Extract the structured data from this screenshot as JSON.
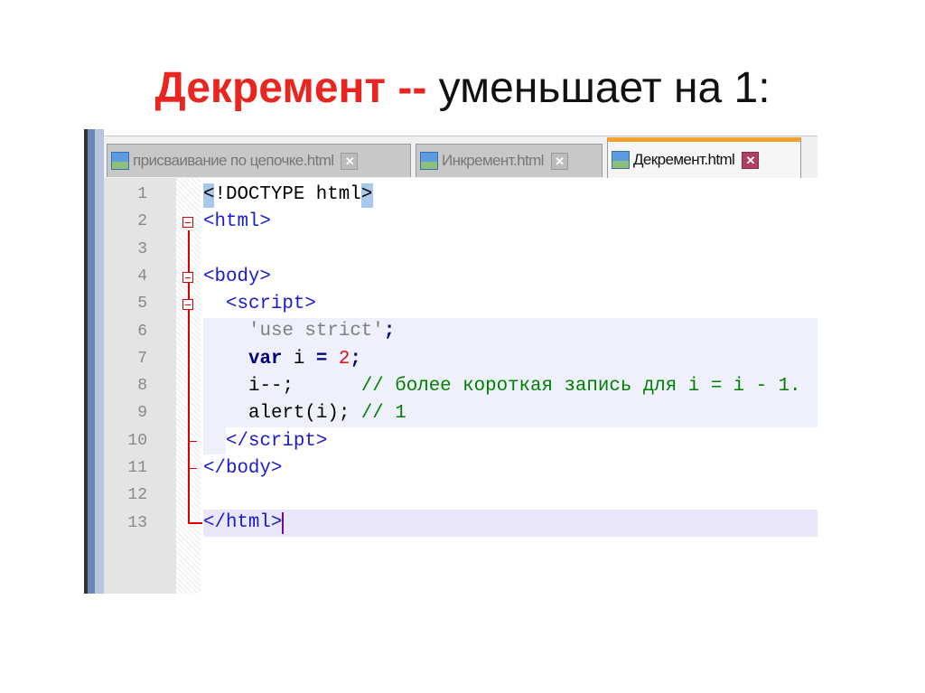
{
  "slide": {
    "title_bold": "Декремент --",
    "title_rest": " уменьшает на 1:"
  },
  "tabs": [
    {
      "label": "присваивание по цепочке.html",
      "close": "✕"
    },
    {
      "label": "Инкремент.html",
      "close": "✕"
    },
    {
      "label": "Декремент.html",
      "close": "✕"
    }
  ],
  "lines": [
    "1",
    "2",
    "3",
    "4",
    "5",
    "6",
    "7",
    "8",
    "9",
    "10",
    "11",
    "12",
    "13"
  ],
  "code": {
    "l1": "<!DOCTYPE html>",
    "l2": "<html>",
    "l4": "<body>",
    "l5": "<script>",
    "l6": "'use strict'",
    "l6b": ";",
    "l7a": "var",
    "l7b": " i ",
    "l7c": "=",
    "l7d": "2",
    "l7e": ";",
    "l8a": "i--;",
    "l8b": "// более короткая запись для i = i - 1.",
    "l9a": "alert(i);",
    "l9b": "// 1",
    "l10": "</script>",
    "l11": "</body>",
    "l13": "</html>"
  },
  "colors": {
    "title_accent": "#e8251f",
    "active_tab_accent": "#f5a030"
  }
}
